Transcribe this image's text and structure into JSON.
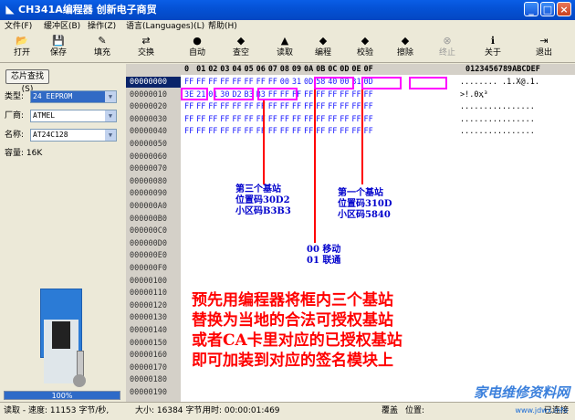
{
  "window": {
    "title": "CH341A编程器  创新电子商贸",
    "minimize": "_",
    "maximize": "□",
    "close": "×"
  },
  "menu": [
    "文件(F)",
    "缓冲区(B)",
    "操作(Z)",
    "语言(Languages)(L)",
    "帮助(H)"
  ],
  "toolbar": [
    {
      "label": "打开",
      "icon": "open-icon",
      "glyph": "📂"
    },
    {
      "label": "保存",
      "icon": "save-icon",
      "glyph": "💾"
    },
    {
      "label": "填充",
      "icon": "fill-icon",
      "glyph": "✎"
    },
    {
      "label": "交换",
      "icon": "swap-icon",
      "glyph": "⇄"
    },
    {
      "label": "自动",
      "icon": "auto-icon",
      "glyph": "●"
    },
    {
      "label": "查空",
      "icon": "blank-check-icon",
      "glyph": "◆"
    },
    {
      "label": "读取",
      "icon": "read-icon",
      "glyph": "▲"
    },
    {
      "label": "编程",
      "icon": "program-icon",
      "glyph": "◆"
    },
    {
      "label": "校验",
      "icon": "verify-icon",
      "glyph": "◆"
    },
    {
      "label": "擦除",
      "icon": "erase-icon",
      "glyph": "◆"
    },
    {
      "label": "终止",
      "icon": "stop-icon",
      "glyph": "⊗"
    },
    {
      "label": "关于",
      "icon": "about-icon",
      "glyph": "ℹ"
    },
    {
      "label": "退出",
      "icon": "exit-icon",
      "glyph": "⇥"
    }
  ],
  "left": {
    "chip_search": "芯片查找(S)",
    "type_label": "类型:",
    "type_value": "24 EEPROM",
    "maker_label": "厂商:",
    "maker_value": "ATMEL",
    "name_label": "名称:",
    "name_value": "AT24C128",
    "capacity": "容量: 16K",
    "progress": "100%",
    "progress_value": 100
  },
  "hex": {
    "header_cols": [
      "0",
      "01",
      "02",
      "03",
      "04",
      "05",
      "06",
      "07",
      "08",
      "09",
      "0A",
      "0B",
      "0C",
      "0D",
      "0E",
      "0F"
    ],
    "ascii_header": "0123456789ABCDEF",
    "rows": [
      {
        "addr": "00000000",
        "bytes": [
          "FF",
          "FF",
          "FF",
          "FF",
          "FF",
          "FF",
          "FF",
          "FF",
          "00",
          "31",
          "0D",
          "58",
          "40",
          "00",
          "31",
          "0D"
        ],
        "ascii": "........ .1.X@.1."
      },
      {
        "addr": "00000010",
        "bytes": [
          "3E",
          "21",
          "01",
          "30",
          "D2",
          "B3",
          "B3",
          "FF",
          "FF",
          "FF",
          "FF",
          "FF",
          "FF",
          "FF",
          "FF",
          "FF"
        ],
        "ascii": ">!.0ҳ³"
      },
      {
        "addr": "00000020",
        "bytes": [
          "FF",
          "FF",
          "FF",
          "FF",
          "FF",
          "FF",
          "FF",
          "FF",
          "FF",
          "FF",
          "FF",
          "FF",
          "FF",
          "FF",
          "FF",
          "FF"
        ],
        "ascii": "................"
      },
      {
        "addr": "00000030",
        "bytes": [
          "FF",
          "FF",
          "FF",
          "FF",
          "FF",
          "FF",
          "FF",
          "FF",
          "FF",
          "FF",
          "FF",
          "FF",
          "FF",
          "FF",
          "FF",
          "FF"
        ],
        "ascii": "................"
      },
      {
        "addr": "00000040",
        "bytes": [
          "FF",
          "FF",
          "FF",
          "FF",
          "FF",
          "FF",
          "FF",
          "FF",
          "FF",
          "FF",
          "FF",
          "FF",
          "FF",
          "FF",
          "FF",
          "FF"
        ],
        "ascii": "................"
      },
      {
        "addr": "00000050",
        "bytes": [],
        "ascii": ""
      },
      {
        "addr": "00000060",
        "bytes": [],
        "ascii": ""
      },
      {
        "addr": "00000070",
        "bytes": [],
        "ascii": ""
      },
      {
        "addr": "00000080",
        "bytes": [],
        "ascii": ""
      },
      {
        "addr": "00000090",
        "bytes": [],
        "ascii": ""
      },
      {
        "addr": "000000A0",
        "bytes": [],
        "ascii": ""
      },
      {
        "addr": "000000B0",
        "bytes": [],
        "ascii": ""
      },
      {
        "addr": "000000C0",
        "bytes": [],
        "ascii": ""
      },
      {
        "addr": "000000D0",
        "bytes": [],
        "ascii": ""
      },
      {
        "addr": "000000E0",
        "bytes": [],
        "ascii": ""
      },
      {
        "addr": "000000F0",
        "bytes": [],
        "ascii": ""
      },
      {
        "addr": "00000100",
        "bytes": [],
        "ascii": ""
      },
      {
        "addr": "00000110",
        "bytes": [],
        "ascii": ""
      },
      {
        "addr": "00000120",
        "bytes": [],
        "ascii": ""
      },
      {
        "addr": "00000130",
        "bytes": [],
        "ascii": ""
      },
      {
        "addr": "00000140",
        "bytes": [],
        "ascii": ""
      },
      {
        "addr": "00000150",
        "bytes": [],
        "ascii": ""
      },
      {
        "addr": "00000160",
        "bytes": [],
        "ascii": ""
      },
      {
        "addr": "00000170",
        "bytes": [],
        "ascii": ""
      },
      {
        "addr": "00000180",
        "bytes": [],
        "ascii": ""
      },
      {
        "addr": "00000190",
        "bytes": [],
        "ascii": ""
      }
    ]
  },
  "annotations": {
    "third_station": [
      "第三个基站",
      "位置码30D2",
      "小区码B3B3"
    ],
    "first_station": [
      "第一个基站",
      "位置码310D",
      "小区码5840"
    ],
    "operator": [
      "00  移动",
      "01  联通"
    ],
    "note_lines": [
      "预先用编程器将框内三个基站",
      "替换为当地的合法可授权基站",
      "或者CA卡里对应的已授权基站",
      "即可加装到对应的签名模块上"
    ]
  },
  "status": {
    "read_speed": "读取 - 速度: 11153 字节/秒,",
    "size": "大小: 16384 字节,",
    "time": "用时: 00:00:01:469",
    "overwrite": "覆盖",
    "position": "位置:",
    "connected": "已连接"
  },
  "watermark": {
    "text": "家电维修资料网",
    "sub": "www.jdwx.info"
  }
}
